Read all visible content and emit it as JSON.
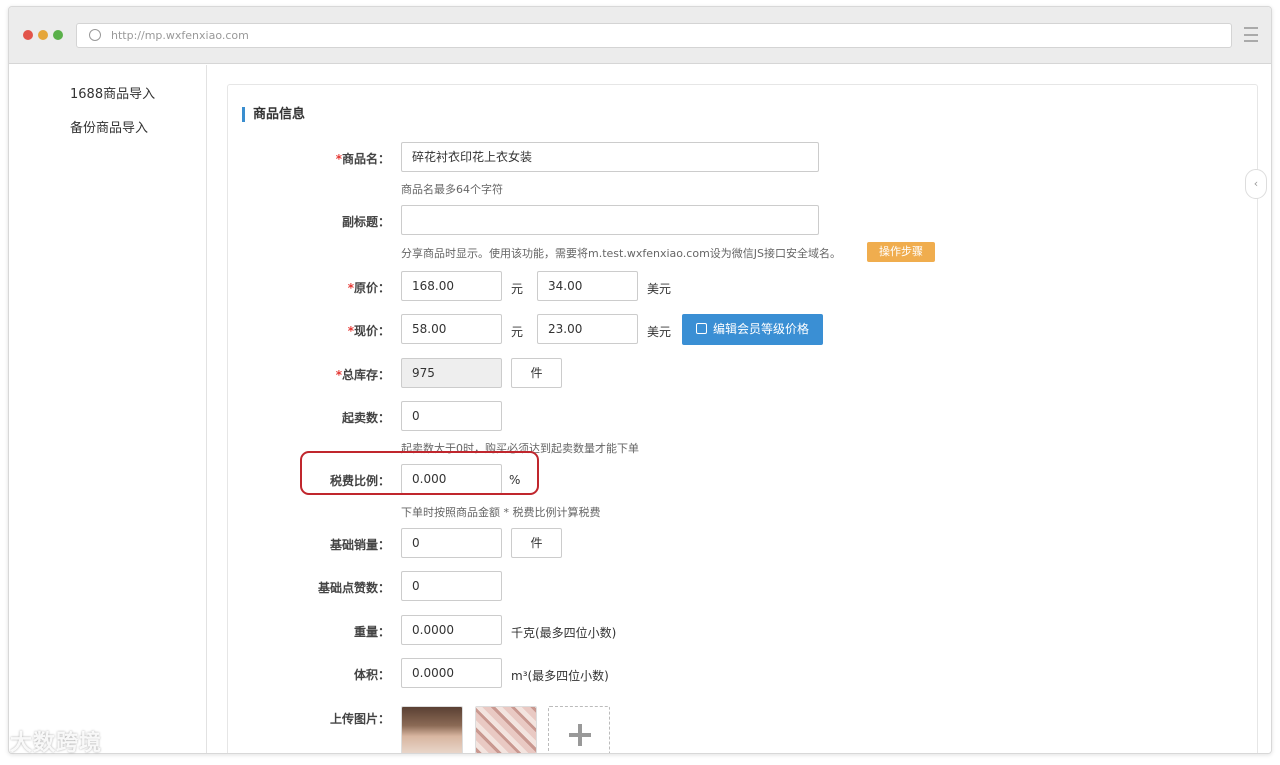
{
  "browser": {
    "url": "http://mp.wxfenxiao.com",
    "dot_colors": [
      "#e2544a",
      "#e5a63a",
      "#5ab04a"
    ]
  },
  "sidebar": {
    "items": [
      {
        "label": "1688商品导入"
      },
      {
        "label": "备份商品导入"
      }
    ]
  },
  "form": {
    "section_title": "商品信息",
    "required_mark": "*",
    "product_name": {
      "label": "商品名：",
      "value": "碎花衬衣印花上衣女装",
      "hint": "商品名最多64个字符"
    },
    "subtitle": {
      "label": "副标题：",
      "value": "",
      "hint": "分享商品时显示。使用该功能，需要将m.test.wxfenxiao.com设为微信JS接口安全域名。",
      "steps_button": "操作步骤"
    },
    "original_price": {
      "label": "原价：",
      "cny_value": "168.00",
      "cny_unit": "元",
      "usd_value": "34.00",
      "usd_unit": "美元"
    },
    "current_price": {
      "label": "现价：",
      "cny_value": "58.00",
      "cny_unit": "元",
      "usd_value": "23.00",
      "usd_unit": "美元",
      "member_price_button": "编辑会员等级价格"
    },
    "total_stock": {
      "label": "总库存：",
      "value": "975",
      "unit": "件"
    },
    "min_order": {
      "label": "起卖数：",
      "value": "0",
      "hint": "起卖数大于0时，购买必须达到起卖数量才能下单"
    },
    "tax_rate": {
      "label": "税费比例：",
      "value": "0.000",
      "unit": "%",
      "hint": "下单时按照商品金额 * 税费比例计算税费"
    },
    "base_sales": {
      "label": "基础销量：",
      "value": "0",
      "unit": "件"
    },
    "base_likes": {
      "label": "基础点赞数：",
      "value": "0"
    },
    "weight": {
      "label": "重量：",
      "value": "0.0000",
      "unit": "千克(最多四位小数)"
    },
    "volume": {
      "label": "体积：",
      "value": "0.0000",
      "unit": "m³(最多四位小数)"
    },
    "upload_images": {
      "label": "上传图片："
    }
  },
  "icons": {
    "address_bar": "refresh-icon",
    "menu": "hamburger-menu-icon",
    "edit": "edit-icon",
    "add": "plus-icon",
    "collapse": "chevron-left-icon"
  },
  "watermark": "大数跨境"
}
